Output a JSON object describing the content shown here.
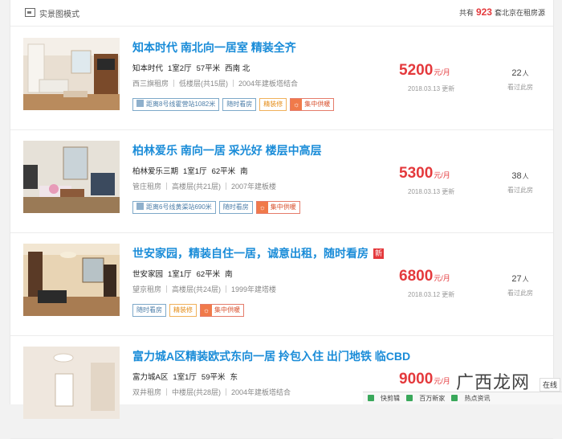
{
  "header": {
    "mode_label": "实景图模式",
    "total_prefix": "共有",
    "total_count": "923",
    "total_suffix": "套北京在租房源"
  },
  "listings": [
    {
      "title": "知本时代 南北向一居室 精装全齐",
      "community": "知本时代",
      "layout": "1室2厅",
      "area": "57平米",
      "orientation": "西南 北",
      "rent_type": "西三旗租房",
      "floor": "低楼层(共15层)",
      "built": "2004年建板塔结合",
      "tags": [
        "距离8号线霍营站1082米",
        "随时看房",
        "精装修",
        "集中供暖"
      ],
      "price": "5200",
      "price_unit": "元/月",
      "updated": "2018.03.13 更新",
      "views": "22",
      "views_unit": "人",
      "views_label": "看过此房"
    },
    {
      "title": "柏林爱乐 南向一居 采光好 楼层中高层",
      "community": "柏林爱乐三期",
      "layout": "1室1厅",
      "area": "62平米",
      "orientation": "南",
      "rent_type": "管庄租房",
      "floor": "高楼层(共21层)",
      "built": "2007年建板楼",
      "tags": [
        "距离6号线黄渠站690米",
        "随时看房",
        "集中供暖"
      ],
      "price": "5300",
      "price_unit": "元/月",
      "updated": "2018.03.13 更新",
      "views": "38",
      "views_unit": "人",
      "views_label": "看过此房"
    },
    {
      "title": "世安家园，精装自住一居，诚意出租，随时看房",
      "badge": "新",
      "community": "世安家园",
      "layout": "1室1厅",
      "area": "62平米",
      "orientation": "南",
      "rent_type": "望京租房",
      "floor": "高楼层(共24层)",
      "built": "1999年建塔楼",
      "tags": [
        "随时看房",
        "精装修",
        "集中供暖"
      ],
      "price": "6800",
      "price_unit": "元/月",
      "updated": "2018.03.12 更新",
      "views": "27",
      "views_unit": "人",
      "views_label": "看过此房"
    },
    {
      "title": "富力城A区精装欧式东向一居 拎包入住 出门地铁 临CBD",
      "community": "富力城A区",
      "layout": "1室1厅",
      "area": "59平米",
      "orientation": "东",
      "rent_type": "双井租房",
      "floor": "中楼层(共28层)",
      "built": "2004年建板塔结合",
      "price": "9000",
      "price_unit": "元/月"
    }
  ],
  "statusbar": {
    "items": [
      "快剪辑",
      "百万新家",
      "热点资讯"
    ]
  },
  "watermark": "广西龙网",
  "side_text": "在线"
}
